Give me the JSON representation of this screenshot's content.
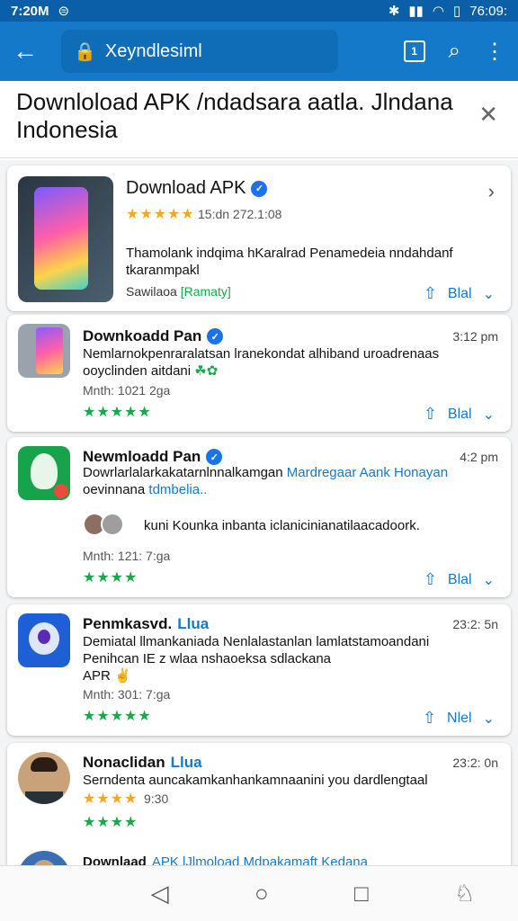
{
  "status_bar": {
    "time": "7:20M",
    "clock_right": "76:09:",
    "icons": [
      "bluetooth-icon",
      "signal-icon",
      "wifi-icon",
      "battery-icon"
    ]
  },
  "app_bar": {
    "url": "Xeyndlesiml"
  },
  "header": {
    "title": "Downloload APK /ndadsara aatla. Jlndana Indonesia"
  },
  "items": [
    {
      "title": "Download APK",
      "rating": "★★★★★",
      "meta": "15:dn 272.1:08",
      "desc": "Thamolank indqima hKaralrad Penamedeia nndahdanf tkaranmpakl",
      "sub_a": "Sawilaoa",
      "sub_link": "[Ramaty]",
      "action": "Blal"
    },
    {
      "title": "Downkoadd Pan",
      "time": "3:12 pm",
      "desc_a": "Nemlarnokpenraralatsan lranekondat alhiband",
      "desc_b": "uroadrenaas ooyclinden aitdani",
      "emoji": "☘✿",
      "meta": "Mnth: 1021 2ga",
      "rating": "★★★★★",
      "action": "Blal"
    },
    {
      "title": "Newmloadd Pan",
      "time": "4:2 pm",
      "desc_a": "Dowrlarlalarkakatarnlnnalkamgan",
      "desc_link": "Mardregaar Aank Honayan",
      "desc_b": "oevinnana",
      "desc_link2": "tdmbelia..",
      "comment": "kuni Kounka inbanta iclanicinianatilaacadoork.",
      "meta": "Mnth: 121: 7:ga",
      "rating": "★★★★",
      "action": "Blal"
    },
    {
      "title": "Penmkasvd.",
      "title_link": "Llua",
      "time": "23:2: 5n",
      "desc_a": "Demiatal llmankaniada Nenlalastanlan lamlatstamoandani",
      "desc_b": "Penihcan IE z wlaa nshaoeksa sdlackana",
      "desc_c": "APR",
      "emoji": "✌",
      "meta": "Mnth: 301: 7:ga",
      "rating": "★★★★★",
      "action": "Nlel"
    },
    {
      "title": "Nonaclidan",
      "title_link": "Llua",
      "time": "23:2: 0n",
      "desc_a": "Serndenta auncakamkanhankamnaanini you dardlengtaal",
      "rating_gold": "★★★★",
      "meta": "9:30",
      "rating": "★★★★"
    },
    {
      "title": "Downlaad",
      "title_link": "APK lJlmoload Mdpakamaft Kedana"
    }
  ],
  "nav": {
    "back": "◁",
    "home": "○",
    "recents": "□",
    "assist": "♘"
  },
  "colors": {
    "statusbar": "#0b5fa8",
    "appbar": "#1479c9",
    "accent": "#1479c9",
    "star_green": "#18a84a",
    "star_gold": "#f5a623"
  }
}
